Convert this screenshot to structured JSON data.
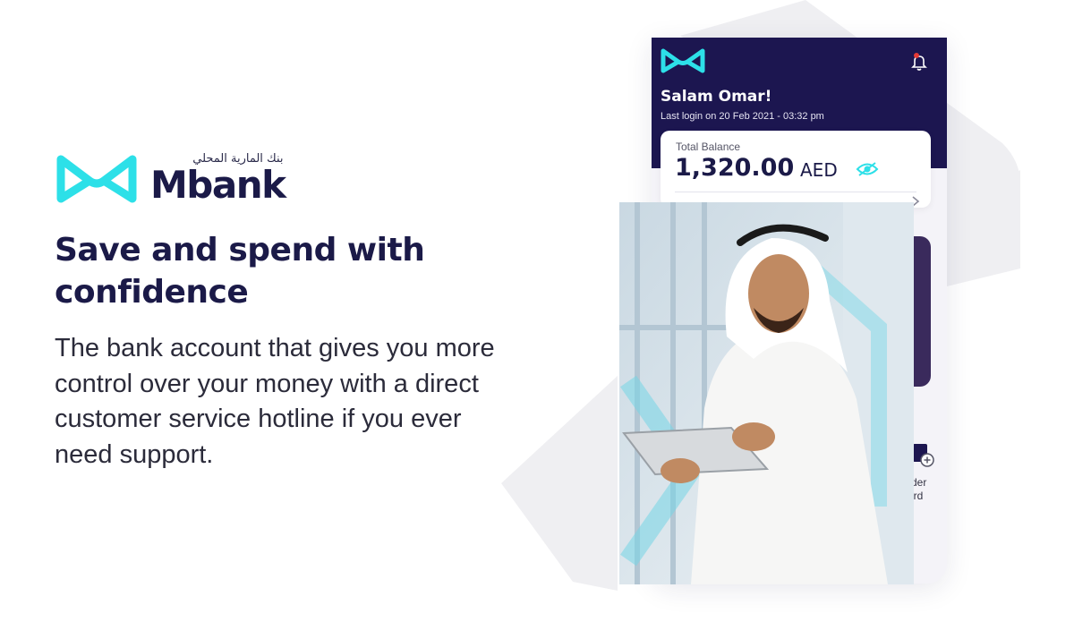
{
  "brand": {
    "arabic_name": "بنك المارية المحلي",
    "name": "Mbank",
    "accent_color": "#2de0e8",
    "navy_color": "#1b1a48"
  },
  "hero": {
    "headline": "Save and spend with confidence",
    "body": "The bank account that gives you more control over your money with a direct customer service hotline if you ever need support."
  },
  "app": {
    "greeting": "Salam Omar!",
    "last_login": "Last login on 20 Feb 2021 - 03:32 pm",
    "balance_label": "Total Balance",
    "balance_amount": "1,320.00",
    "balance_currency": "AED",
    "order_card_label_line1": "rder",
    "order_card_label_line2": "ard",
    "icons": {
      "logo": "mbank-logo-icon",
      "notification": "bell-icon",
      "toggle_visibility": "eye-icon",
      "chevron": "chevron-right-icon",
      "order_card": "card-add-icon"
    }
  },
  "photo": {
    "subject": "man-with-tablet-image"
  }
}
